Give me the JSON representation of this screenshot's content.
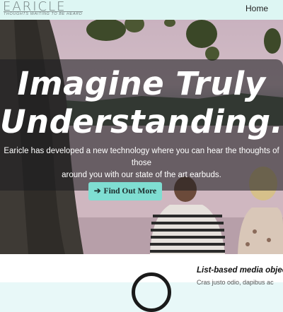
{
  "brand": {
    "name": "EARICLE",
    "tagline": "THOUGHTS WAITING TO BE HEARD"
  },
  "nav": {
    "items": [
      {
        "label": "Home"
      }
    ]
  },
  "hero": {
    "headline_line1": "Imagine Truly",
    "headline_line2": "Understanding...",
    "subtext_line1": "Earicle has developed a new technology where you can hear the thoughts of those",
    "subtext_line2": "around you with our state of the art earbuds.",
    "cta_label": "Find Out More",
    "cta_icon": "arrow-right-icon"
  },
  "media": {
    "title": "List-based media object",
    "text": "Cras justo odio, dapibus ac"
  },
  "colors": {
    "navbar_bg": "#ddf6f3",
    "cta_bg": "#7fded2",
    "overlay": "rgba(30,30,32,0.58)"
  }
}
